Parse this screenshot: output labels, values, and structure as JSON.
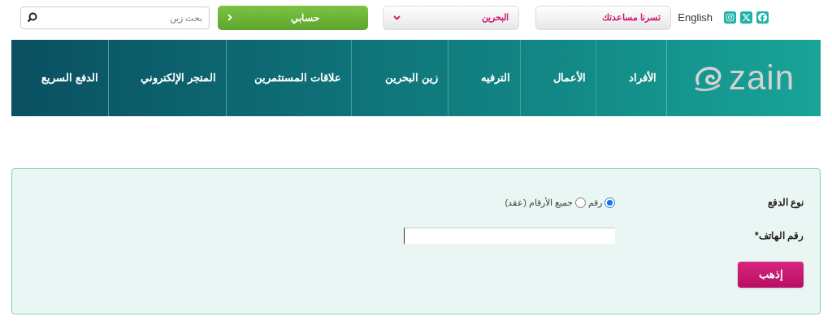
{
  "top_bar": {
    "social": [
      {
        "kind": "facebook"
      },
      {
        "kind": "x"
      },
      {
        "kind": "instagram"
      }
    ],
    "language": "English",
    "help_dropdown": {
      "value": "تسرنا مساعدتك"
    },
    "country_dropdown": {
      "value": "البحرين"
    },
    "account_button": "حسابي",
    "search": {
      "placeholder": "بحث زين"
    }
  },
  "nav": {
    "logo": "zain",
    "items": [
      {
        "label": "الأفراد"
      },
      {
        "label": "الأعمال"
      },
      {
        "label": "الترفيه"
      },
      {
        "label": "زين البحرين"
      },
      {
        "label": "علاقات المستثمرين"
      },
      {
        "label": "المتجر الإلكتروني"
      },
      {
        "label": "الدفع السريع"
      }
    ]
  },
  "form": {
    "payment_type": {
      "label": "نوع الدفع",
      "options": [
        {
          "label": "رقم",
          "selected": true
        },
        {
          "label": "جميع الأرقام (عقد)",
          "selected": false
        }
      ]
    },
    "phone": {
      "label": "رقم الهاتف*"
    },
    "submit": "إذهب"
  }
}
